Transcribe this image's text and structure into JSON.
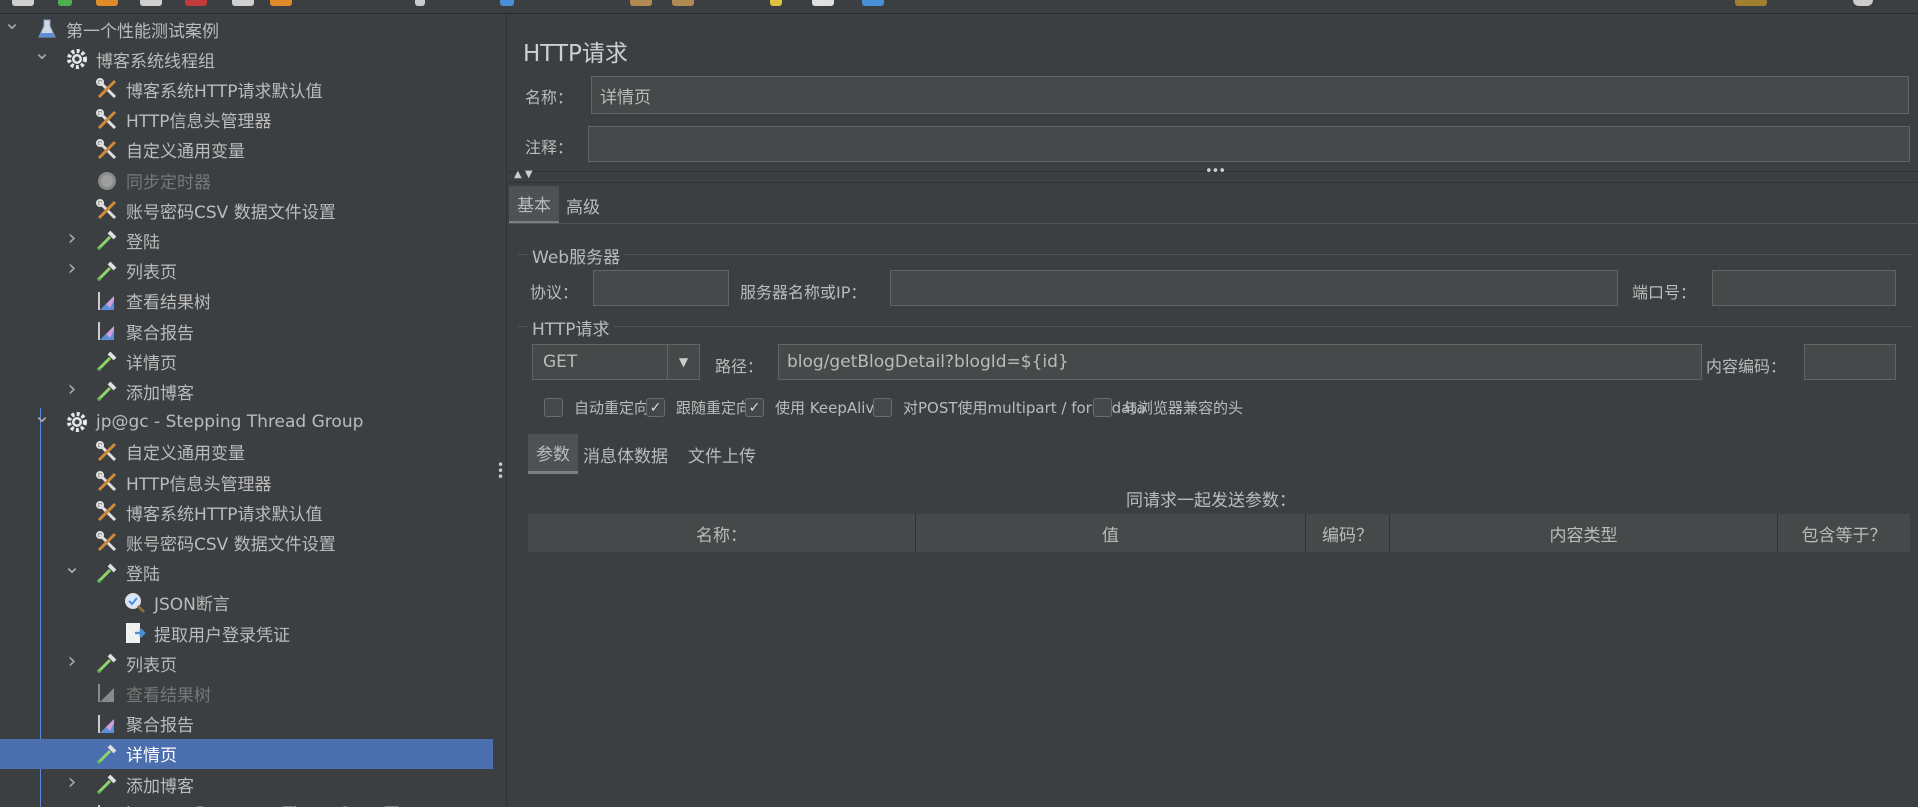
{
  "tree": {
    "items": [
      {
        "label": "第一个性能测试案例",
        "arrow": "expanded",
        "icon": "flask-icon"
      },
      {
        "label": "博客系统线程组",
        "arrow": "expanded",
        "icon": "gear-icon"
      },
      {
        "label": "博客系统HTTP请求默认值",
        "arrow": "",
        "icon": "wrench-screwdriver-icon"
      },
      {
        "label": "HTTP信息头管理器",
        "arrow": "",
        "icon": "wrench-screwdriver-icon"
      },
      {
        "label": "自定义通用变量",
        "arrow": "",
        "icon": "wrench-screwdriver-icon"
      },
      {
        "label": "同步定时器",
        "arrow": "",
        "icon": "timer-icon",
        "disabled": true
      },
      {
        "label": "账号密码CSV 数据文件设置",
        "arrow": "",
        "icon": "wrench-screwdriver-icon"
      },
      {
        "label": "登陆",
        "arrow": "collapsed",
        "icon": "pipette-icon"
      },
      {
        "label": "列表页",
        "arrow": "collapsed",
        "icon": "pipette-icon"
      },
      {
        "label": "查看结果树",
        "arrow": "",
        "icon": "chart-listener-icon"
      },
      {
        "label": "聚合报告",
        "arrow": "",
        "icon": "chart-listener-icon"
      },
      {
        "label": "详情页",
        "arrow": "",
        "icon": "pipette-icon"
      },
      {
        "label": "添加博客",
        "arrow": "collapsed",
        "icon": "pipette-icon"
      },
      {
        "label": "jp@gc - Stepping Thread Group",
        "arrow": "expanded",
        "icon": "gear-icon"
      },
      {
        "label": "自定义通用变量",
        "arrow": "",
        "icon": "wrench-screwdriver-icon"
      },
      {
        "label": "HTTP信息头管理器",
        "arrow": "",
        "icon": "wrench-screwdriver-icon"
      },
      {
        "label": "博客系统HTTP请求默认值",
        "arrow": "",
        "icon": "wrench-screwdriver-icon"
      },
      {
        "label": "账号密码CSV 数据文件设置",
        "arrow": "",
        "icon": "wrench-screwdriver-icon"
      },
      {
        "label": "登陆",
        "arrow": "expanded",
        "icon": "pipette-icon"
      },
      {
        "label": "JSON断言",
        "arrow": "",
        "icon": "magnifier-assertion-icon"
      },
      {
        "label": "提取用户登录凭证",
        "arrow": "",
        "icon": "extractor-icon"
      },
      {
        "label": "列表页",
        "arrow": "collapsed",
        "icon": "pipette-icon"
      },
      {
        "label": "查看结果树",
        "arrow": "",
        "icon": "chart-listener-icon",
        "disabled": true
      },
      {
        "label": "聚合报告",
        "arrow": "",
        "icon": "chart-listener-icon"
      },
      {
        "label": "详情页",
        "arrow": "",
        "icon": "pipette-icon",
        "selected": true
      },
      {
        "label": "添加博客",
        "arrow": "collapsed",
        "icon": "pipette-icon"
      },
      {
        "label": "jp@gc - Response Times Over Time",
        "arrow": "",
        "icon": "chart-listener-icon"
      }
    ]
  },
  "panel": {
    "title": "HTTP请求",
    "name_label": "名称：",
    "name_value": "详情页",
    "comment_label": "注释：",
    "comment_value": "",
    "tabs": [
      "基本",
      "高级"
    ],
    "web_server": {
      "group_title": "Web服务器",
      "protocol_label": "协议：",
      "protocol_value": "",
      "server_label": "服务器名称或IP：",
      "server_value": "",
      "port_label": "端口号：",
      "port_value": ""
    },
    "http_request": {
      "group_title": "HTTP请求",
      "method": "GET",
      "path_label": "路径：",
      "path_value": "blog/getBlogDetail?blogId=${id}",
      "encoding_label": "内容编码：",
      "encoding_value": ""
    },
    "checkboxes": [
      {
        "label": "自动重定向",
        "checked": false
      },
      {
        "label": "跟随重定向",
        "checked": true
      },
      {
        "label": "使用 KeepAlive",
        "checked": true
      },
      {
        "label": "对POST使用multipart / form-data",
        "checked": false
      },
      {
        "label": "与浏览器兼容的头",
        "checked": false
      }
    ],
    "sub_tabs": [
      "参数",
      "消息体数据",
      "文件上传"
    ],
    "params_caption": "同请求一起发送参数：",
    "table_headers": [
      "名称：",
      "值",
      "编码？",
      "内容类型",
      "包含等于？"
    ]
  },
  "colors": {
    "background": "#3c3f41",
    "selected_row": "#4b6eaf",
    "field_bg": "#45494a"
  }
}
